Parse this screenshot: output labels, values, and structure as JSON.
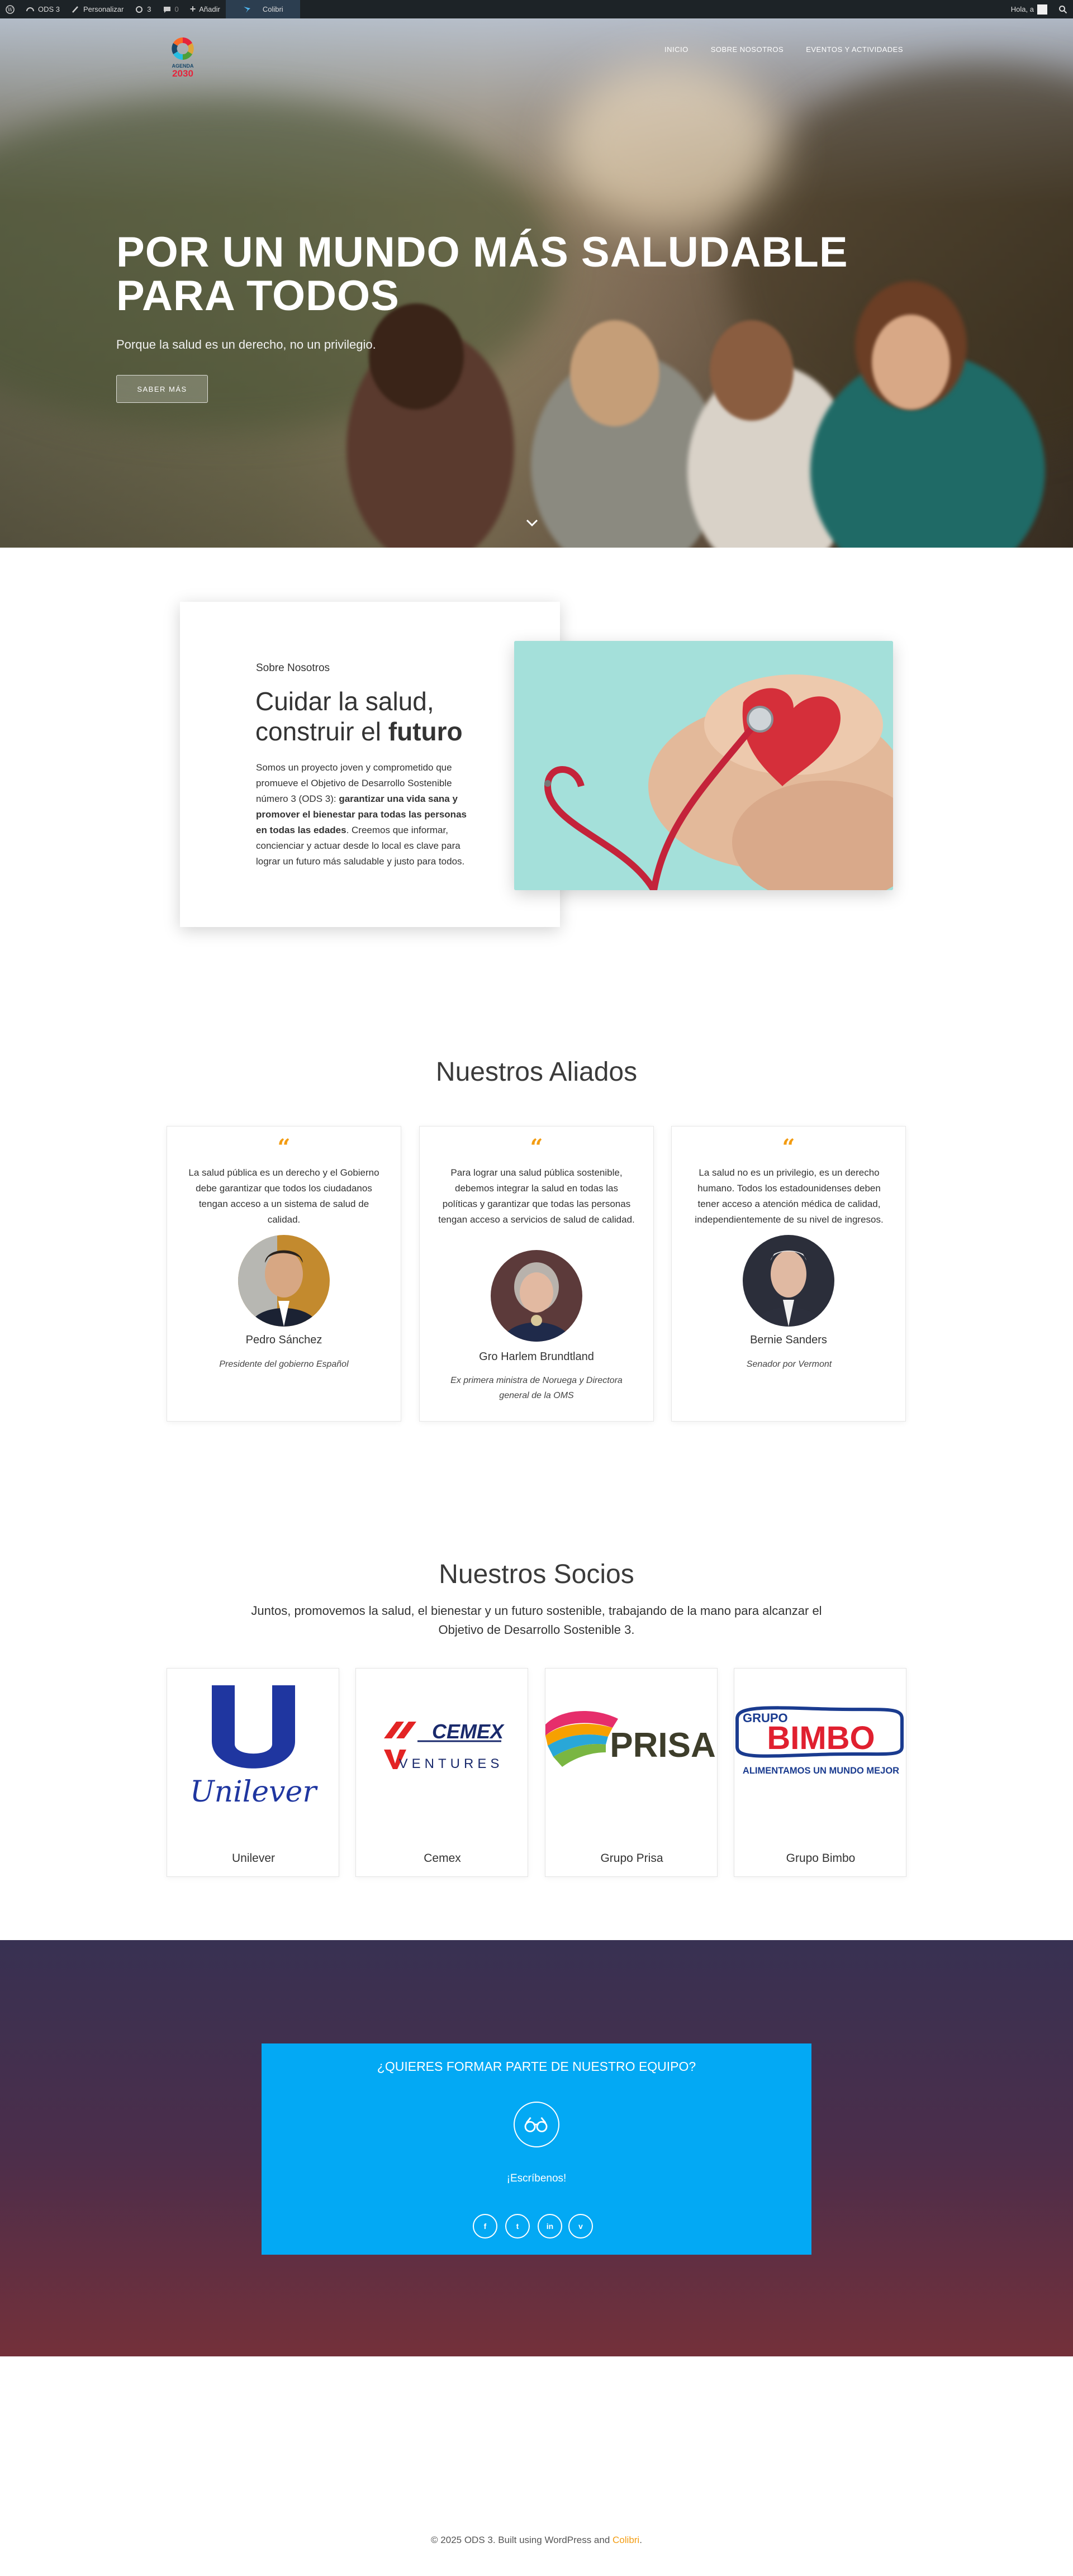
{
  "adminbar": {
    "site_name": "ODS 3",
    "customize": "Personalizar",
    "updates_count": "3",
    "comments_count": "0",
    "add_new": "Añadir",
    "theme_link": "Colibri",
    "greeting": "Hola, a"
  },
  "header": {
    "logo_text_top": "AGENDA",
    "logo_text_bottom": "2030",
    "nav": [
      "INICIO",
      "SOBRE NOSOTROS",
      "EVENTOS Y ACTIVIDADES"
    ]
  },
  "hero": {
    "title_line1": "POR UN MUNDO MÁS SALUDABLE",
    "title_line2": "PARA TODOS",
    "subtitle": "Porque la salud es un derecho, no un privilegio.",
    "button": "SABER MÁS"
  },
  "about": {
    "label": "Sobre Nosotros",
    "title_part1": "Cuidar la salud,",
    "title_part2": "construir el",
    "title_bold": "futuro",
    "text_start": "Somos un proyecto joven y comprometido que promueve el Objetivo de Desarrollo Sostenible número 3 (ODS 3):",
    "text_bold": "garantizar una vida sana y promover el bienestar para todas las personas en todas las edades",
    "text_end": ". Creemos que informar, concienciar y actuar desde lo local es clave para lograr un futuro más saludable y justo para todos."
  },
  "allies": {
    "title": "Nuestros Aliados",
    "items": [
      {
        "quote": "La salud pública es un derecho y el Gobierno debe garantizar que todos los ciudadanos tengan acceso a un sistema de salud de calidad.",
        "name": "Pedro Sánchez",
        "role": "Presidente del gobierno Español"
      },
      {
        "quote": "Para lograr una salud pública sostenible, debemos integrar la salud en todas las políticas y garantizar que todas las personas tengan acceso a servicios de salud de calidad.",
        "name": "Gro Harlem Brundtland",
        "role": "Ex primera ministra de Noruega y Directora general de la OMS"
      },
      {
        "quote": "La salud no es un privilegio, es un derecho humano. Todos los estadounidenses deben tener acceso a atención médica de calidad, independientemente de su nivel de ingresos.",
        "name": "Bernie Sanders",
        "role": "Senador por Vermont"
      }
    ]
  },
  "partners": {
    "title": "Nuestros Socios",
    "subtitle": "Juntos, promovemos la salud, el bienestar y un futuro sostenible, trabajando de la mano para alcanzar el Objetivo de Desarrollo Sostenible 3.",
    "items": [
      {
        "name": "Unilever",
        "logo_text": "Unilever"
      },
      {
        "name": "Cemex",
        "logo_text": "CEMEX",
        "logo_sub": "VENTURES"
      },
      {
        "name": "Grupo Prisa",
        "logo_text": "PRISA"
      },
      {
        "name": "Grupo Bimbo",
        "logo_top": "GRUPO",
        "logo_text": "BIMBO",
        "logo_sub": "ALIMENTAMOS UN MUNDO MEJOR"
      }
    ]
  },
  "cta": {
    "title": "¿QUIERES FORMAR PARTE DE NUESTRO EQUIPO?",
    "link": "¡Escríbenos!",
    "social": [
      "f",
      "t",
      "in",
      "v"
    ]
  },
  "footer": {
    "text": "© 2025 ODS 3. Built using WordPress and",
    "link": "Colibri",
    "end": "."
  },
  "colors": {
    "accent": "#f39c12",
    "cta_blue": "#03a9f4",
    "admin_bar": "#1d2327"
  }
}
